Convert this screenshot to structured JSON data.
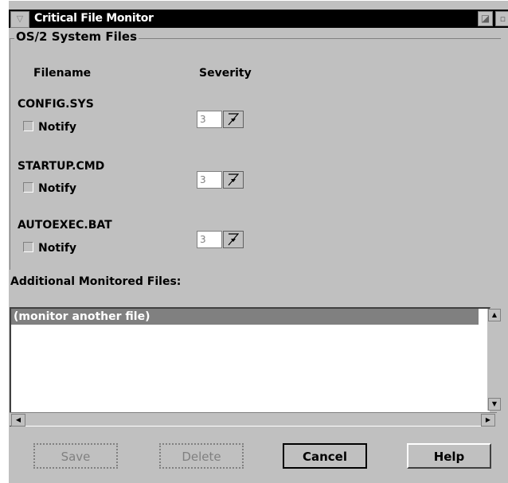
{
  "window": {
    "title": "Critical File Monitor",
    "sysmenu_icon": "collapse-icon",
    "max_icon": "maximize-icon",
    "min_icon": "minimize-icon"
  },
  "group": {
    "label": "OS/2 System Files",
    "col_filename": "Filename",
    "col_severity": "Severity",
    "files": [
      {
        "name": "CONFIG.SYS",
        "notify_label": "Notify",
        "notify_checked": false,
        "severity": "3"
      },
      {
        "name": "STARTUP.CMD",
        "notify_label": "Notify",
        "notify_checked": false,
        "severity": "3"
      },
      {
        "name": "AUTOEXEC.BAT",
        "notify_label": "Notify",
        "notify_checked": false,
        "severity": "3"
      }
    ]
  },
  "additional": {
    "label": "Additional Monitored Files:",
    "items": [
      "(monitor another file)"
    ]
  },
  "buttons": {
    "save": "Save",
    "delete": "Delete",
    "cancel": "Cancel",
    "help": "Help"
  },
  "colors": {
    "face": "#c0c0c0",
    "selection": "#808080",
    "titlebar": "#000000"
  }
}
